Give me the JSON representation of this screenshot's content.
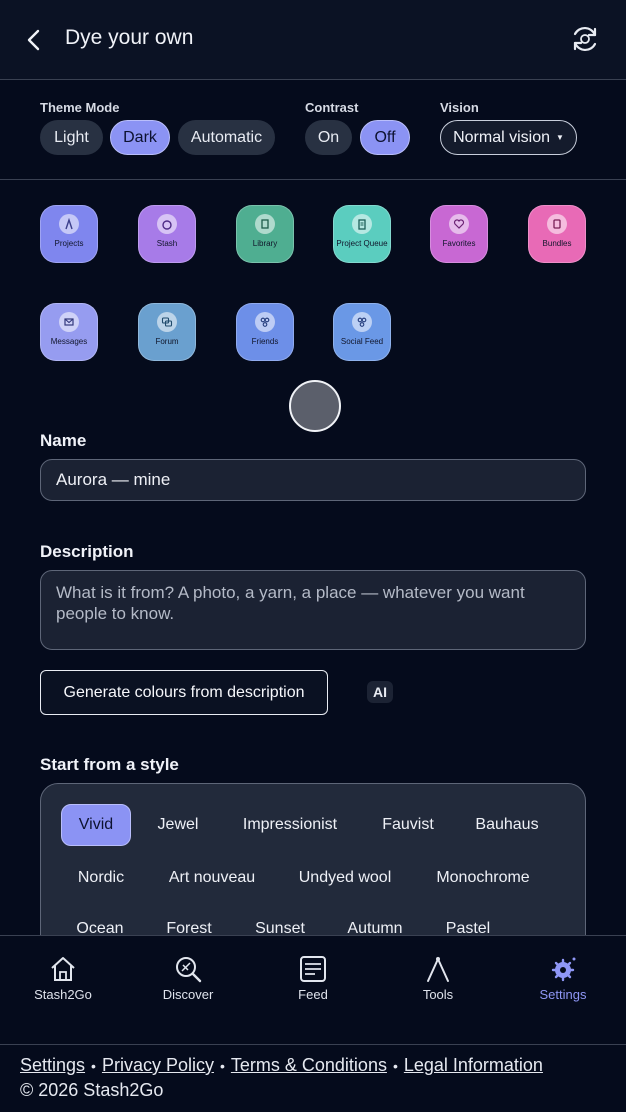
{
  "header": {
    "title": "Dye your own"
  },
  "theme_mode": {
    "label": "Theme Mode",
    "options": [
      "Light",
      "Dark",
      "Automatic"
    ],
    "selected": "Dark"
  },
  "contrast": {
    "label": "Contrast",
    "options": [
      "On",
      "Off"
    ],
    "selected": "Off"
  },
  "vision": {
    "label": "Vision",
    "selected": "Normal vision"
  },
  "apps": [
    {
      "label": "Projects",
      "color": "#7f86ee"
    },
    {
      "label": "Stash",
      "color": "#a77be8"
    },
    {
      "label": "Library",
      "color": "#4fae91"
    },
    {
      "label": "Project Queue",
      "color": "#5bcdbf"
    },
    {
      "label": "Favorites",
      "color": "#c868d3"
    },
    {
      "label": "Bundles",
      "color": "#e86ab6"
    },
    {
      "label": "Messages",
      "color": "#969cf0"
    },
    {
      "label": "Forum",
      "color": "#6aa0cf"
    },
    {
      "label": "Friends",
      "color": "#6d8fe8"
    },
    {
      "label": "Social Feed",
      "color": "#6a98e6"
    }
  ],
  "orb_color": "#5b5f6b",
  "name_field": {
    "label": "Name",
    "value": "Aurora — mine"
  },
  "description_field": {
    "label": "Description",
    "placeholder": "What is it from? A photo, a yarn, a place — whatever you want people to know."
  },
  "generate_button": "Generate colours from description",
  "ai_badge": "AI",
  "styles": {
    "label": "Start from a style",
    "selected": "Vivid",
    "rows": [
      [
        "Vivid",
        "Jewel",
        "Impressionist",
        "Fauvist",
        "Bauhaus"
      ],
      [
        "Nordic",
        "Art nouveau",
        "Undyed wool",
        "Monochrome"
      ],
      [
        "Ocean",
        "Forest",
        "Sunset",
        "Autumn",
        "Pastel"
      ]
    ]
  },
  "nav": [
    {
      "label": "Stash2Go",
      "icon": "home-icon"
    },
    {
      "label": "Discover",
      "icon": "discover-icon"
    },
    {
      "label": "Feed",
      "icon": "feed-icon"
    },
    {
      "label": "Tools",
      "icon": "tools-icon"
    },
    {
      "label": "Settings",
      "icon": "settings-icon",
      "active": true
    }
  ],
  "footer": {
    "links": [
      "Settings",
      "Privacy Policy",
      "Terms & Conditions",
      "Legal Information"
    ],
    "copyright": "© 2026 Stash2Go"
  },
  "colors": {
    "accent": "#8b93f4",
    "background": "#050b1c"
  }
}
